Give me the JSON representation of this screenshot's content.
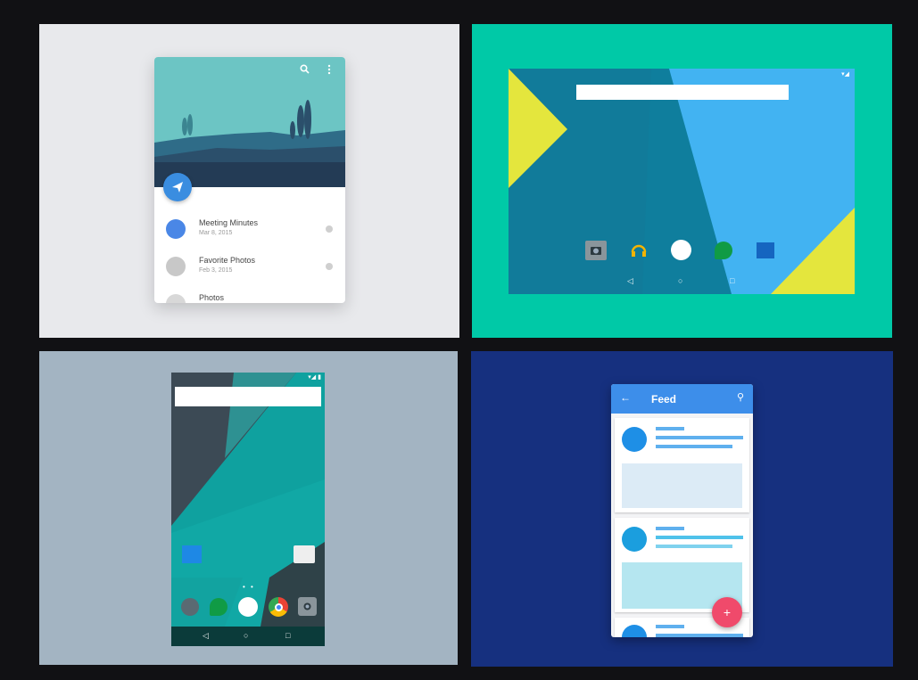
{
  "panel_email": {
    "cards": [
      {
        "title": "Meeting Minutes",
        "date": "Mar 8, 2015"
      },
      {
        "title": "Favorite Photos",
        "date": "Feb 3, 2015"
      },
      {
        "title": "Photos",
        "date": ""
      }
    ],
    "icons": [
      "search-icon",
      "more-vert-icon",
      "send-icon"
    ]
  },
  "panel_tablet": {
    "status": "▾◢",
    "dock": [
      "camera-icon",
      "headphones-icon",
      "apps-icon",
      "hangouts-icon",
      "calendar-icon"
    ],
    "nav": {
      "back": "◁",
      "home": "○",
      "recents": "□"
    }
  },
  "panel_phone": {
    "status": "▾◢ ▮",
    "page_dots": "• •",
    "dock": [
      "settings-icon",
      "hangouts-icon",
      "apps-icon",
      "chrome-icon",
      "camera-icon"
    ],
    "nav": {
      "back": "◁",
      "home": "○",
      "recents": "□"
    }
  },
  "panel_feed": {
    "title": "Feed",
    "back": "←",
    "search": "⚲",
    "fab": "+"
  },
  "colors": {
    "teal_panel": "#00c9a7",
    "navy_panel": "#16307f",
    "gray_panel": "#a3b4c2",
    "light_panel": "#e8e9ec",
    "accent_blue": "#3d8eea",
    "accent_pink": "#f04a6b"
  }
}
